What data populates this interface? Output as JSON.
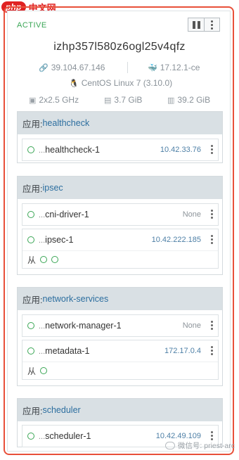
{
  "brand": {
    "badge": "php",
    "text": "中文网"
  },
  "host": {
    "state": "ACTIVE",
    "hostname": "izhp357l580z6ogl25v4qfz",
    "ip": "39.104.67.146",
    "docker_version": "17.12.1-ce",
    "os": "CentOS Linux 7 (3.10.0)",
    "cpu": "2x2.5 GHz",
    "memory": "3.7 GiB",
    "storage": "39.2 GiB",
    "status_color": "#3aa655",
    "accent_color": "#e8503a"
  },
  "stack_prefix": "应用:",
  "sidekick_label": "从",
  "stacks": [
    {
      "name": "healthcheck",
      "services": [
        {
          "name": "healthcheck-1",
          "ip": "10.42.33.76"
        }
      ]
    },
    {
      "name": "ipsec",
      "services": [
        {
          "name": "cni-driver-1",
          "ip": "None"
        },
        {
          "name": "ipsec-1",
          "ip": "10.42.222.185"
        }
      ]
    },
    {
      "name": "network-services",
      "services": [
        {
          "name": "network-manager-1",
          "ip": "None"
        },
        {
          "name": "metadata-1",
          "ip": "172.17.0.4"
        }
      ]
    },
    {
      "name": "scheduler",
      "services": [
        {
          "name": "scheduler-1",
          "ip": "10.42.49.109"
        }
      ]
    }
  ],
  "watermark": "微信号: priest-arc"
}
